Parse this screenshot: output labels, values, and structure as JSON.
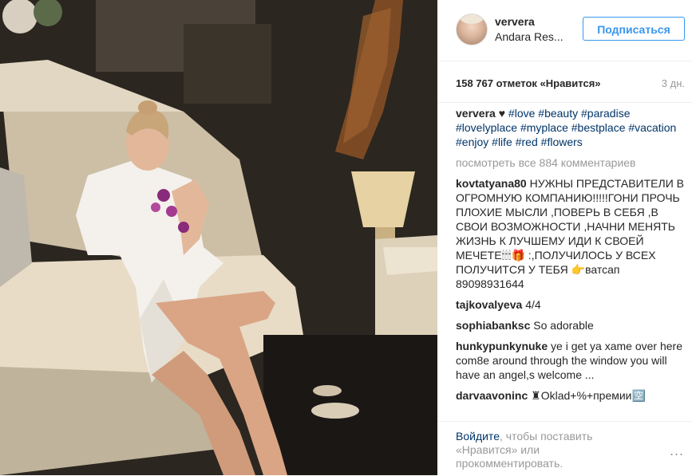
{
  "post": {
    "username": "ververa",
    "location": "Andara Res...",
    "follow_label": "Подписаться",
    "likes": "158 767 отметок «Нравится»",
    "time": "3 дн."
  },
  "caption": {
    "user": "ververa",
    "heart": "♥",
    "hashtags": [
      "#love",
      "#beauty",
      "#paradise",
      "#lovelyplace",
      "#myplace",
      "#bestplace",
      "#vacation",
      "#enjoy",
      "#life",
      "#red",
      "#flowers"
    ]
  },
  "view_all": "посмотреть все 884 комментариев",
  "comments": [
    {
      "user": "kovtatyana80",
      "text": "НУЖНЫ ПРЕДСТАВИТЕЛИ В ОГРОМНУЮ КОМПАНИЮ!!!!!ГОНИ ПРОЧЬ ПЛОХИЕ МЫСЛИ ,ПОВЕРЬ В СЕБЯ ,В СВОИ ВОЗМОЖНОСТИ ,НАЧНИ МЕНЯТЬ ЖИЗНЬ К ЛУЧШЕМУ ИДИ К СВОЕЙ МЕЧЕТЕ🕯🕯🕯🎁 :,ПОЛУЧИЛОСЬ У ВСЕХ ПОЛУЧИТСЯ У ТЕБЯ 👉ватсап 89098931644"
    },
    {
      "user": "tajkovalyeva",
      "text": "4/4"
    },
    {
      "user": "sophiabanksc",
      "text": "So adorable"
    },
    {
      "user": "hunkypunkynuke",
      "text": "ye i get ya xame over here com8e around through the window you will have an angel,s welcome ..."
    },
    {
      "user": "darvaavoninc",
      "text": "♜Oklad+%+премии🈳"
    }
  ],
  "footer": {
    "login_link": "Войдите",
    "login_text": ", чтобы поставить «Нравится» или прокомментировать.",
    "more": "..."
  }
}
